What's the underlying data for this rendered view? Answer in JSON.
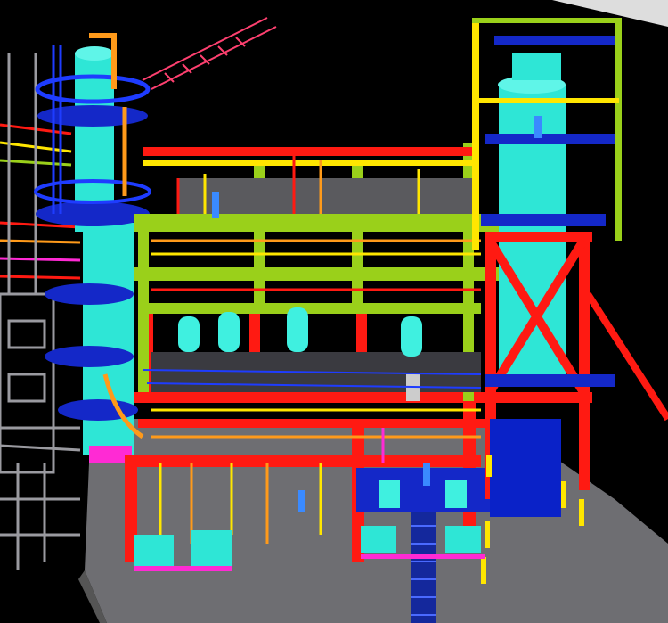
{
  "scene": {
    "background": "#000000",
    "palette": {
      "tower": "#2ee6d6",
      "tower_dark": "#1fb8aa",
      "steel_red": "#ff1a12",
      "steel_green": "#9ad01a",
      "pipe_yellow": "#ffe600",
      "pipe_orange": "#ff9a1a",
      "platform_blue": "#1428c8",
      "handrail_blue": "#1e3cff",
      "ground_gray": "#6e6e72",
      "structure_gray": "#9a9aa0",
      "magenta": "#ff2ad4",
      "tank_blue": "#0a22c8",
      "vessel_cyan": "#3ff0e0"
    }
  }
}
